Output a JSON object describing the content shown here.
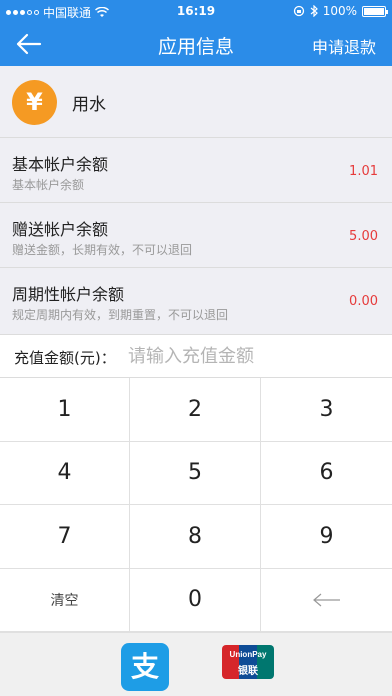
{
  "status": {
    "carrier": "中国联通",
    "time": "16:19",
    "battery_percent": "100%",
    "battery_level": 1.0
  },
  "nav": {
    "title": "应用信息",
    "refund_label": "申请退款"
  },
  "app": {
    "icon_symbol": "¥",
    "icon_color": "#f59a23",
    "name": "用水"
  },
  "accounts": [
    {
      "name": "基本帐户余额",
      "desc": "基本帐户余额",
      "amount": "1.01"
    },
    {
      "name": "赠送帐户余额",
      "desc": "赠送金额，长期有效，不可以退回",
      "amount": "5.00"
    },
    {
      "name": "周期性帐户余额",
      "desc": "规定周期内有效，到期重置，不可以退回",
      "amount": "0.00"
    }
  ],
  "recharge": {
    "label": "充值金额(元)：",
    "placeholder": "请输入充值金额"
  },
  "keypad": {
    "keys": [
      "1",
      "2",
      "3",
      "4",
      "5",
      "6",
      "7",
      "8",
      "9",
      "清空",
      "0",
      "←"
    ]
  },
  "payment": {
    "alipay_glyph": "支",
    "unionpay_text": "UnionPay",
    "unionpay_cn": "银联"
  },
  "colors": {
    "brand": "#2b8ce8",
    "amount": "#e63b3b",
    "alipay": "#1e9de6"
  }
}
